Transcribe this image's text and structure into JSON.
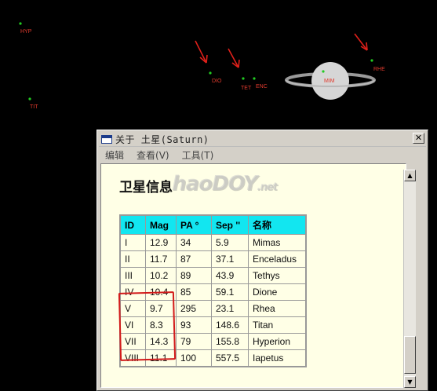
{
  "sky": {
    "background": "#000000",
    "moon_color": "#22cc22",
    "label_color": "#e23b2e",
    "moons": [
      {
        "label": "HYP"
      },
      {
        "label": "TIT"
      },
      {
        "label": "DIO"
      },
      {
        "label": "TET"
      },
      {
        "label": "ENC"
      },
      {
        "label": "MIM"
      },
      {
        "label": "RHE"
      }
    ]
  },
  "dialog": {
    "title": "关于 土星(Saturn)",
    "close_glyph": "✕",
    "menu": [
      "编辑",
      "查看(V)",
      "工具(T)"
    ],
    "heading": "卫星信息",
    "watermark_main": "haoDOY",
    "watermark_suffix": ".net",
    "table": {
      "header_color": "#12e6f0",
      "columns": [
        "ID",
        "Mag",
        "PA °",
        "Sep ''",
        "名称"
      ],
      "rows": [
        [
          "I",
          "12.9",
          "34",
          "5.9",
          "Mimas"
        ],
        [
          "II",
          "11.7",
          "87",
          "37.1",
          "Enceladus"
        ],
        [
          "III",
          "10.2",
          "89",
          "43.9",
          "Tethys"
        ],
        [
          "IV",
          "10.4",
          "85",
          "59.1",
          "Dione"
        ],
        [
          "V",
          "9.7",
          "295",
          "23.1",
          "Rhea"
        ],
        [
          "VI",
          "8.3",
          "93",
          "148.6",
          "Titan"
        ],
        [
          "VII",
          "14.3",
          "79",
          "155.8",
          "Hyperion"
        ],
        [
          "VIII",
          "11.1",
          "100",
          "557.5",
          "Iapetus"
        ]
      ]
    },
    "scroll_up_glyph": "▲",
    "scroll_down_glyph": "▼"
  }
}
